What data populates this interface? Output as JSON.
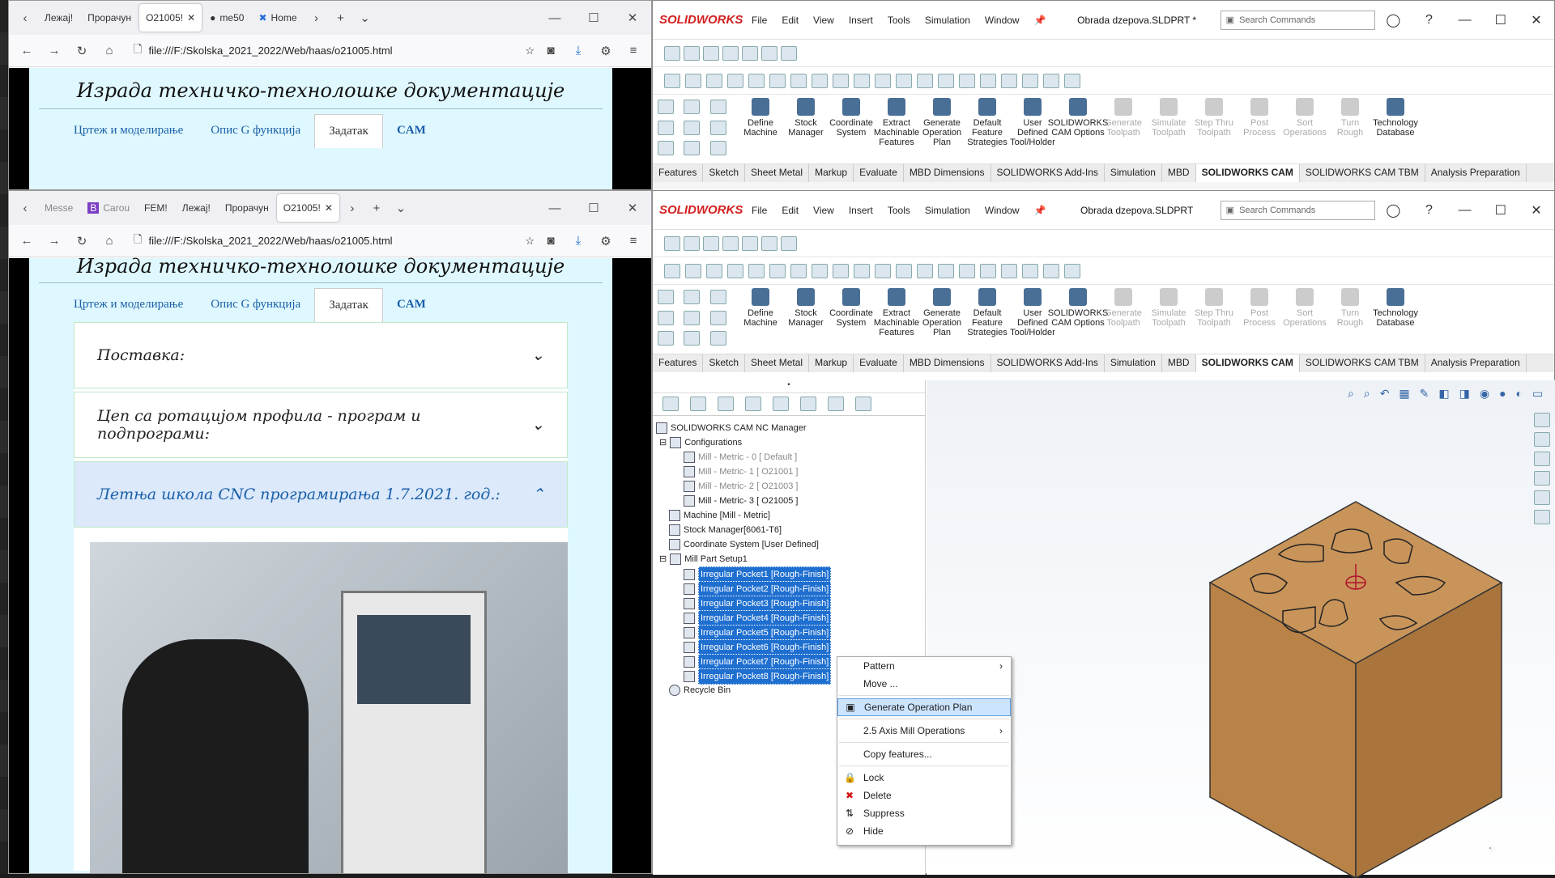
{
  "browser1": {
    "tabs": [
      "Лежај!",
      "Прорачун",
      "O21005!",
      "me50",
      "Home"
    ],
    "active_tab": "O21005!",
    "url": "file:///F:/Skolska_2021_2022/Web/haas/o21005.html",
    "heading": "Израда техничко-технолошке документације",
    "nav": [
      "Цртеж и моделирање",
      "Опис G функција",
      "Задатак",
      "CAM"
    ]
  },
  "browser2": {
    "tabs": [
      "Messe",
      "Carou",
      "FEM!",
      "Лежај!",
      "Прорачун",
      "O21005!"
    ],
    "active_tab": "O21005!",
    "url": "file:///F:/Skolska_2021_2022/Web/haas/o21005.html",
    "heading": "Израда техничко-технолошке документације",
    "nav": [
      "Цртеж и моделирање",
      "Опис G функција",
      "Задатак",
      "CAM"
    ],
    "accordions": [
      "Поставка:",
      "Цеп са ротацијом профила - програм и подпрограми:",
      "Летња школа CNC програмирања 1.7.2021. год.:"
    ]
  },
  "sw1": {
    "logo": "SOLIDWORKS",
    "menu": [
      "File",
      "Edit",
      "View",
      "Insert",
      "Tools",
      "Simulation",
      "Window"
    ],
    "document": "Obrada dzepova.SLDPRT *",
    "search_placeholder": "Search Commands"
  },
  "sw2": {
    "logo": "SOLIDWORKS",
    "menu": [
      "File",
      "Edit",
      "View",
      "Insert",
      "Tools",
      "Simulation",
      "Window"
    ],
    "document": "Obrada dzepova.SLDPRT",
    "search_placeholder": "Search Commands"
  },
  "ribbon": [
    {
      "label": "Define Machine",
      "enabled": true
    },
    {
      "label": "Stock Manager",
      "enabled": true
    },
    {
      "label": "Coordinate System",
      "enabled": true
    },
    {
      "label": "Extract Machinable Features",
      "enabled": true
    },
    {
      "label": "Generate Operation Plan",
      "enabled": true
    },
    {
      "label": "Default Feature Strategies",
      "enabled": true
    },
    {
      "label": "User Defined Tool/Holder",
      "enabled": true
    },
    {
      "label": "SOLIDWORKS CAM Options",
      "enabled": true
    },
    {
      "label": "Generate Toolpath",
      "enabled": false
    },
    {
      "label": "Simulate Toolpath",
      "enabled": false
    },
    {
      "label": "Step Thru Toolpath",
      "enabled": false
    },
    {
      "label": "Post Process",
      "enabled": false
    },
    {
      "label": "Sort Operations",
      "enabled": false
    },
    {
      "label": "Turn Rough",
      "enabled": false
    },
    {
      "label": "Technology Database",
      "enabled": true
    }
  ],
  "cm_tabs": [
    "Features",
    "Sketch",
    "Sheet Metal",
    "Markup",
    "Evaluate",
    "MBD Dimensions",
    "SOLIDWORKS Add-Ins",
    "Simulation",
    "MBD",
    "SOLIDWORKS CAM",
    "SOLIDWORKS CAM TBM",
    "Analysis Preparation"
  ],
  "active_cm_tab": "SOLIDWORKS CAM",
  "tree": {
    "root": "SOLIDWORKS CAM NC Manager",
    "configurations": "Configurations",
    "configs": [
      "Mill - Metric - 0 [ Default ]",
      "Mill - Metric- 1 [ O21001 ]",
      "Mill - Metric- 2 [ O21003 ]",
      "Mill - Metric- 3 [ O21005 ]"
    ],
    "machine": "Machine [Mill - Metric]",
    "stock": "Stock Manager[6061-T6]",
    "coord": "Coordinate System [User Defined]",
    "setup": "Mill Part Setup1",
    "pockets": [
      "Irregular Pocket1 [Rough-Finish]",
      "Irregular Pocket2 [Rough-Finish]",
      "Irregular Pocket3 [Rough-Finish]",
      "Irregular Pocket4 [Rough-Finish]",
      "Irregular Pocket5 [Rough-Finish]",
      "Irregular Pocket6 [Rough-Finish]",
      "Irregular Pocket7 [Rough-Finish]",
      "Irregular Pocket8 [Rough-Finish]"
    ],
    "recycle": "Recycle Bin"
  },
  "context_menu": {
    "pattern": "Pattern",
    "move": "Move ...",
    "generate": "Generate Operation Plan",
    "mill_ops": "2.5 Axis Mill Operations",
    "copy": "Copy features...",
    "lock": "Lock",
    "delete": "Delete",
    "suppress": "Suppress",
    "hide": "Hide"
  }
}
